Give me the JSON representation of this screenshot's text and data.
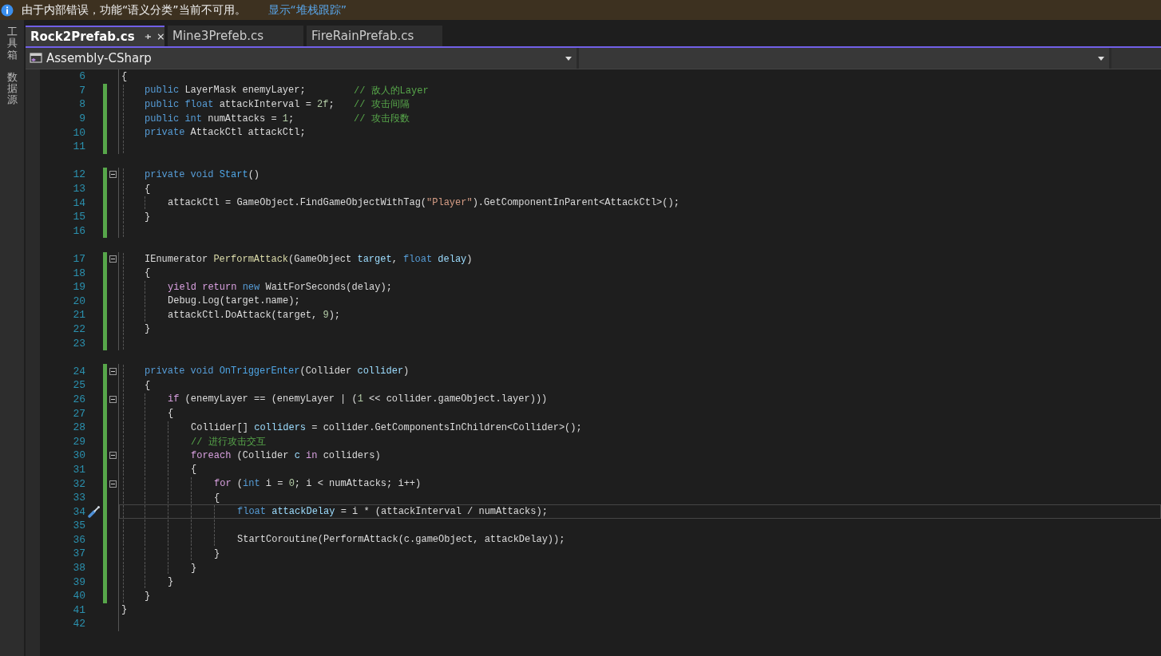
{
  "infobar": {
    "message": "由于内部错误，功能“语义分类”当前不可用。",
    "link": "显示“堆栈跟踪”"
  },
  "side_tabs": [
    "工具箱",
    "数据源"
  ],
  "tabs": [
    {
      "label": "Rock2Prefab.cs",
      "selected": true
    },
    {
      "label": "Mine3Prefeb.cs",
      "selected": false
    },
    {
      "label": "FireRainPrefab.cs",
      "selected": false
    }
  ],
  "navbar": {
    "project": "Assembly-CSharp"
  },
  "lines": [
    {
      "number": "6",
      "tokens": [
        {
          "text": "{",
          "kind": "plain"
        }
      ],
      "changed": false,
      "fold": false,
      "gap_before": false,
      "selected": false,
      "children": [
        {
          "number": "7",
          "tokens": [
            {
              "text": "public ",
              "kind": "keyword"
            },
            {
              "text": "LayerMask enemyLayer;",
              "kind": "plain"
            }
          ],
          "comment": "// 敌人的Layer",
          "changed": true,
          "fold": false,
          "gap_before": false,
          "selected": false
        },
        {
          "number": "8",
          "tokens": [
            {
              "text": "public ",
              "kind": "keyword"
            },
            {
              "text": "float",
              "kind": "keyword"
            },
            {
              "text": " attackInterval = ",
              "kind": "plain"
            },
            {
              "text": "2f",
              "kind": "number"
            },
            {
              "text": ";",
              "kind": "plain"
            }
          ],
          "comment": "// 攻击间隔",
          "changed": true,
          "fold": false,
          "gap_before": false,
          "selected": false
        },
        {
          "number": "9",
          "tokens": [
            {
              "text": "public ",
              "kind": "keyword"
            },
            {
              "text": "int",
              "kind": "keyword"
            },
            {
              "text": " numAttacks = ",
              "kind": "plain"
            },
            {
              "text": "1",
              "kind": "number"
            },
            {
              "text": ";",
              "kind": "plain"
            }
          ],
          "comment": "// 攻击段数",
          "changed": true,
          "fold": false,
          "gap_before": false,
          "selected": false
        },
        {
          "number": "10",
          "tokens": [
            {
              "text": "private ",
              "kind": "keyword"
            },
            {
              "text": "AttackCtl attackCtl;",
              "kind": "plain"
            }
          ],
          "changed": true,
          "fold": false,
          "gap_before": false,
          "selected": false
        },
        {
          "number": "11",
          "changed": true,
          "fold": false,
          "gap_before": false,
          "selected": false
        },
        {
          "number": "12",
          "tokens": [
            {
              "text": "private void ",
              "kind": "keyword"
            },
            {
              "text": "Start",
              "kind": "declaration"
            },
            {
              "text": "()",
              "kind": "plain"
            }
          ],
          "changed": true,
          "fold": true,
          "gap_before": true,
          "selected": false
        },
        {
          "number": "13",
          "tokens": [
            {
              "text": "{",
              "kind": "plain"
            }
          ],
          "changed": true,
          "fold": false,
          "gap_before": false,
          "selected": false,
          "children": [
            {
              "number": "14",
              "tokens": [
                {
                  "text": "attackCtl = GameObject.FindGameObjectWithTag(",
                  "kind": "plain"
                },
                {
                  "text": "\"Player\"",
                  "kind": "string"
                },
                {
                  "text": ").GetComponentInParent<AttackCtl>();",
                  "kind": "plain"
                }
              ],
              "changed": true,
              "fold": false,
              "gap_before": false,
              "selected": false
            }
          ]
        },
        {
          "number": "15",
          "tokens": [
            {
              "text": "}",
              "kind": "plain"
            }
          ],
          "changed": true,
          "fold": false,
          "gap_before": false,
          "selected": false
        },
        {
          "number": "16",
          "changed": true,
          "fold": false,
          "gap_before": false,
          "selected": false
        },
        {
          "number": "17",
          "tokens": [
            {
              "text": "IEnumerator ",
              "kind": "plain"
            },
            {
              "text": "PerformAttack",
              "kind": "method"
            },
            {
              "text": "(GameObject ",
              "kind": "plain"
            },
            {
              "text": "target",
              "kind": "variable"
            },
            {
              "text": ", ",
              "kind": "plain"
            },
            {
              "text": "float ",
              "kind": "keyword"
            },
            {
              "text": "delay",
              "kind": "variable"
            },
            {
              "text": ")",
              "kind": "plain"
            }
          ],
          "changed": true,
          "fold": true,
          "gap_before": true,
          "selected": false
        },
        {
          "number": "18",
          "tokens": [
            {
              "text": "{",
              "kind": "plain"
            }
          ],
          "changed": true,
          "fold": false,
          "gap_before": false,
          "selected": false,
          "children": [
            {
              "number": "19",
              "tokens": [
                {
                  "text": "yield return ",
                  "kind": "control"
                },
                {
                  "text": "new ",
                  "kind": "keyword"
                },
                {
                  "text": "WaitForSeconds(delay);",
                  "kind": "plain"
                }
              ],
              "changed": true,
              "fold": false,
              "gap_before": false,
              "selected": false
            },
            {
              "number": "20",
              "tokens": [
                {
                  "text": "Debug.Log(target.name);",
                  "kind": "plain"
                }
              ],
              "changed": true,
              "fold": false,
              "gap_before": false,
              "selected": false
            },
            {
              "number": "21",
              "tokens": [
                {
                  "text": "attackCtl.DoAttack(target, ",
                  "kind": "plain"
                },
                {
                  "text": "9",
                  "kind": "number"
                },
                {
                  "text": ");",
                  "kind": "plain"
                }
              ],
              "changed": true,
              "fold": false,
              "gap_before": false,
              "selected": false
            }
          ]
        },
        {
          "number": "22",
          "tokens": [
            {
              "text": "}",
              "kind": "plain"
            }
          ],
          "changed": true,
          "fold": false,
          "gap_before": false,
          "selected": false
        },
        {
          "number": "23",
          "changed": true,
          "fold": false,
          "gap_before": false,
          "selected": false
        },
        {
          "number": "24",
          "tokens": [
            {
              "text": "private void ",
              "kind": "keyword"
            },
            {
              "text": "OnTriggerEnter",
              "kind": "declaration"
            },
            {
              "text": "(Collider ",
              "kind": "plain"
            },
            {
              "text": "collider",
              "kind": "variable"
            },
            {
              "text": ")",
              "kind": "plain"
            }
          ],
          "changed": true,
          "fold": true,
          "gap_before": true,
          "selected": false
        },
        {
          "number": "25",
          "tokens": [
            {
              "text": "{",
              "kind": "plain"
            }
          ],
          "changed": true,
          "fold": false,
          "gap_before": false,
          "selected": false,
          "children": [
            {
              "number": "26",
              "tokens": [
                {
                  "text": "if ",
                  "kind": "control"
                },
                {
                  "text": "(enemyLayer == (enemyLayer | (",
                  "kind": "plain"
                },
                {
                  "text": "1",
                  "kind": "number"
                },
                {
                  "text": " << collider.gameObject.layer)))",
                  "kind": "plain"
                }
              ],
              "changed": true,
              "fold": true,
              "gap_before": false,
              "selected": false
            },
            {
              "number": "27",
              "tokens": [
                {
                  "text": "{",
                  "kind": "plain"
                }
              ],
              "changed": true,
              "fold": false,
              "gap_before": false,
              "selected": false,
              "children": [
                {
                  "number": "28",
                  "tokens": [
                    {
                      "text": "Collider[] ",
                      "kind": "plain"
                    },
                    {
                      "text": "colliders",
                      "kind": "variable"
                    },
                    {
                      "text": " = collider.GetComponentsInChildren<Collider>();",
                      "kind": "plain"
                    }
                  ],
                  "changed": true,
                  "fold": false,
                  "gap_before": false,
                  "selected": false
                },
                {
                  "number": "29",
                  "tokens": [
                    {
                      "text": "// 进行攻击交互",
                      "kind": "comment"
                    }
                  ],
                  "changed": true,
                  "fold": false,
                  "gap_before": false,
                  "selected": false
                },
                {
                  "number": "30",
                  "tokens": [
                    {
                      "text": "foreach ",
                      "kind": "control"
                    },
                    {
                      "text": "(Collider ",
                      "kind": "plain"
                    },
                    {
                      "text": "c ",
                      "kind": "variable"
                    },
                    {
                      "text": "in",
                      "kind": "control"
                    },
                    {
                      "text": " colliders)",
                      "kind": "plain"
                    }
                  ],
                  "changed": true,
                  "fold": true,
                  "gap_before": false,
                  "selected": false
                },
                {
                  "number": "31",
                  "tokens": [
                    {
                      "text": "{",
                      "kind": "plain"
                    }
                  ],
                  "changed": true,
                  "fold": false,
                  "gap_before": false,
                  "selected": false,
                  "children": [
                    {
                      "number": "32",
                      "tokens": [
                        {
                          "text": "for ",
                          "kind": "control"
                        },
                        {
                          "text": "(",
                          "kind": "plain"
                        },
                        {
                          "text": "int ",
                          "kind": "keyword"
                        },
                        {
                          "text": "i = ",
                          "kind": "plain"
                        },
                        {
                          "text": "0",
                          "kind": "number"
                        },
                        {
                          "text": "; i < numAttacks; i++)",
                          "kind": "plain"
                        }
                      ],
                      "changed": true,
                      "fold": true,
                      "gap_before": false,
                      "selected": false
                    },
                    {
                      "number": "33",
                      "tokens": [
                        {
                          "text": "{",
                          "kind": "plain"
                        }
                      ],
                      "changed": true,
                      "fold": false,
                      "gap_before": false,
                      "selected": false,
                      "children": [
                        {
                          "number": "34",
                          "tokens": [
                            {
                              "text": "float ",
                              "kind": "keyword"
                            },
                            {
                              "text": "attackDelay",
                              "kind": "variable"
                            },
                            {
                              "text": " = i * (attackInterval / numAttacks);",
                              "kind": "plain"
                            }
                          ],
                          "changed": true,
                          "fold": false,
                          "gap_before": false,
                          "selected": true
                        },
                        {
                          "number": "35",
                          "changed": true,
                          "fold": false,
                          "gap_before": false,
                          "selected": false
                        },
                        {
                          "number": "36",
                          "tokens": [
                            {
                              "text": "StartCoroutine(PerformAttack(c.gameObject, attackDelay));",
                              "kind": "plain"
                            }
                          ],
                          "changed": true,
                          "fold": false,
                          "gap_before": false,
                          "selected": false
                        }
                      ]
                    },
                    {
                      "number": "37",
                      "tokens": [
                        {
                          "text": "}",
                          "kind": "plain"
                        }
                      ],
                      "changed": true,
                      "fold": false,
                      "gap_before": false,
                      "selected": false
                    }
                  ]
                },
                {
                  "number": "38",
                  "tokens": [
                    {
                      "text": "}",
                      "kind": "plain"
                    }
                  ],
                  "changed": true,
                  "fold": false,
                  "gap_before": false,
                  "selected": false
                }
              ]
            },
            {
              "number": "39",
              "tokens": [
                {
                  "text": "}",
                  "kind": "plain"
                }
              ],
              "changed": true,
              "fold": false,
              "gap_before": false,
              "selected": false
            }
          ]
        },
        {
          "number": "40",
          "tokens": [
            {
              "text": "}",
              "kind": "plain"
            }
          ],
          "changed": true,
          "fold": false,
          "gap_before": false,
          "selected": false
        }
      ]
    },
    {
      "number": "41",
      "tokens": [
        {
          "text": "}",
          "kind": "plain"
        }
      ],
      "changed": false,
      "fold": false,
      "gap_before": false,
      "selected": false
    },
    {
      "number": "42",
      "changed": false,
      "fold": false,
      "gap_before": false,
      "selected": false
    }
  ]
}
